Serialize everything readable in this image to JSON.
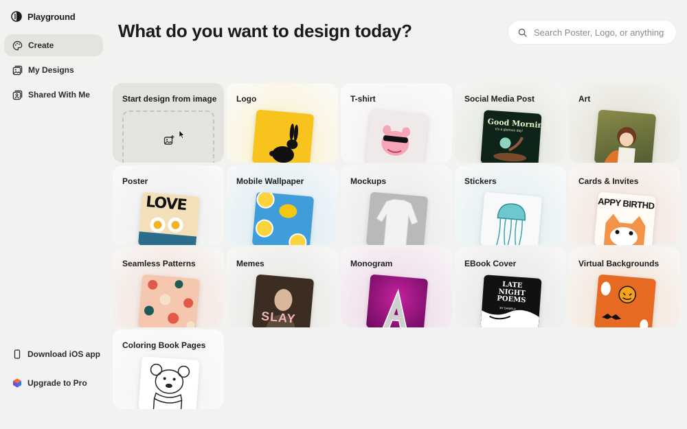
{
  "app": {
    "name": "Playground"
  },
  "sidebar": {
    "items": [
      {
        "label": "Create",
        "icon": "palette-icon",
        "active": true
      },
      {
        "label": "My Designs",
        "icon": "image-stack-icon",
        "active": false
      },
      {
        "label": "Shared With Me",
        "icon": "shared-image-icon",
        "active": false
      }
    ],
    "download_label": "Download iOS app",
    "upgrade_label": "Upgrade to Pro"
  },
  "header": {
    "title": "What do you want to design today?",
    "search_placeholder": "Search Poster, Logo, or anything"
  },
  "cards": [
    {
      "label": "Start design from image",
      "kind": "upload"
    },
    {
      "label": "Logo",
      "glow": "#fdeeb0",
      "thumb": "#f7c31c"
    },
    {
      "label": "T-shirt",
      "glow": "#f6f3f4",
      "thumb": "#f0e9ea"
    },
    {
      "label": "Social Media Post",
      "glow": "#dfe5dc",
      "thumb": "#0f2418",
      "text": "Good Morning",
      "subtext": "It's a glorious day!"
    },
    {
      "label": "Art",
      "glow": "#e6e2d2",
      "thumb": "#5c6a3e"
    },
    {
      "label": "Poster",
      "glow": "#eef0f2",
      "thumb": "#f3e0b8",
      "text": "LOVE"
    },
    {
      "label": "Mobile Wallpaper",
      "glow": "#e0eef6",
      "thumb": "#3f9ed9"
    },
    {
      "label": "Mockups",
      "glow": "#ededed",
      "thumb": "#b9b9b9"
    },
    {
      "label": "Stickers",
      "glow": "#e8f2f4",
      "thumb": "#f7f9fa"
    },
    {
      "label": "Cards & Invites",
      "glow": "#fbefe8",
      "thumb": "#fffaf4",
      "text": "APPY BIRTHD"
    },
    {
      "label": "Seamless Patterns",
      "glow": "#f8e8e0",
      "thumb": "#f4c7ae"
    },
    {
      "label": "Memes",
      "glow": "#ececea",
      "thumb": "#3b2d22",
      "text": "SLAY"
    },
    {
      "label": "Monogram",
      "glow": "#f3dbee",
      "thumb": "#a5178f"
    },
    {
      "label": "EBook Cover",
      "glow": "#ececec",
      "thumb": "#111111",
      "text": "LATE NIGHT POEMS",
      "subtext": "BY DANIELA"
    },
    {
      "label": "Virtual Backgrounds",
      "glow": "#fbe9dc",
      "thumb": "#e66a22"
    },
    {
      "label": "Coloring Book Pages",
      "glow": "#f8f8f8",
      "thumb": "#ffffff"
    }
  ]
}
